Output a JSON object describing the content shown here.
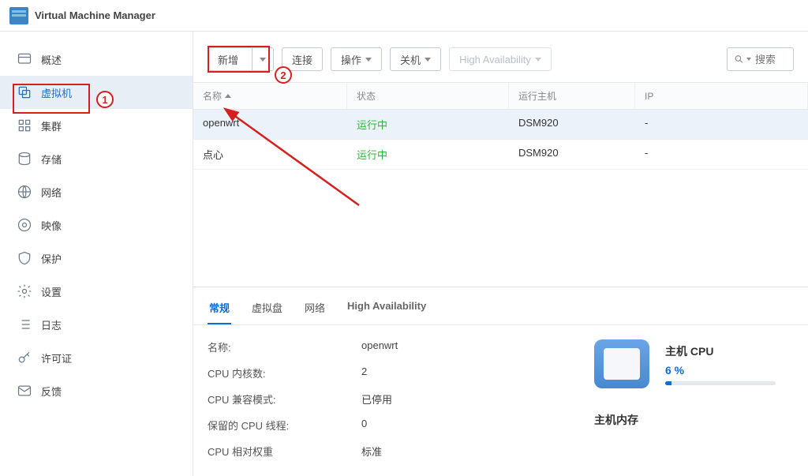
{
  "app": {
    "title": "Virtual Machine Manager"
  },
  "sidebar": {
    "items": [
      {
        "label": "概述"
      },
      {
        "label": "虚拟机"
      },
      {
        "label": "集群"
      },
      {
        "label": "存储"
      },
      {
        "label": "网络"
      },
      {
        "label": "映像"
      },
      {
        "label": "保护"
      },
      {
        "label": "设置"
      },
      {
        "label": "日志"
      },
      {
        "label": "许可证"
      },
      {
        "label": "反馈"
      }
    ]
  },
  "toolbar": {
    "add": "新增",
    "connect": "连接",
    "action": "操作",
    "shutdown": "关机",
    "ha": "High Availability",
    "search_placeholder": "搜索"
  },
  "table": {
    "headers": {
      "name": "名称",
      "status": "状态",
      "host": "运行主机",
      "ip": "IP"
    },
    "rows": [
      {
        "name": "openwrt",
        "status": "运行中",
        "host": "DSM920",
        "ip": "-"
      },
      {
        "name": "点心",
        "status": "运行中",
        "host": "DSM920",
        "ip": "-"
      }
    ]
  },
  "detail": {
    "tabs": {
      "general": "常规",
      "vdisk": "虚拟盘",
      "network": "网络",
      "ha": "High Availability"
    },
    "kv": {
      "name_k": "名称:",
      "name_v": "openwrt",
      "cpu_k": "CPU 内核数:",
      "cpu_v": "2",
      "compat_k": "CPU 兼容模式:",
      "compat_v": "已停用",
      "reserved_k": "保留的 CPU 线程:",
      "reserved_v": "0",
      "weight_k": "CPU 相对权重",
      "weight_v": "标准"
    },
    "host_cpu": {
      "title": "主机 CPU",
      "pct_text": "6 %",
      "pct_value": 6
    },
    "host_mem_title": "主机内存"
  },
  "annotations": {
    "one": "1",
    "two": "2"
  }
}
